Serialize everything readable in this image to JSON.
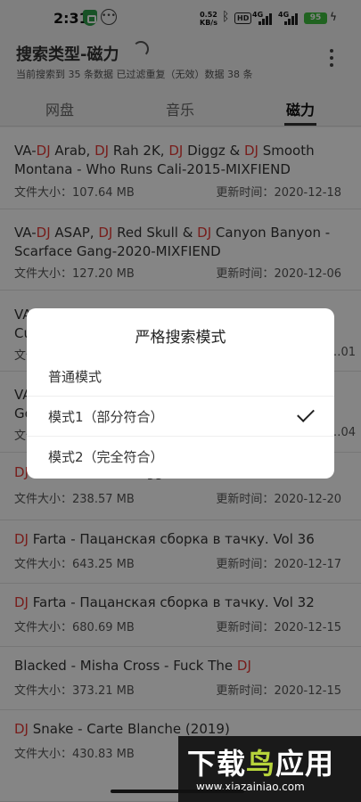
{
  "status_bar": {
    "time": "2:31",
    "speed_value": "0.52",
    "speed_unit": "KB/s",
    "hd": "HD",
    "net1": "4G",
    "net2": "4G",
    "battery": "95"
  },
  "header": {
    "title": "搜索类型-磁力",
    "subtitle": "当前搜索到 35 条数据 已过滤重复（无效）数据 38 条"
  },
  "tabs": [
    {
      "label": "网盘",
      "active": false
    },
    {
      "label": "音乐",
      "active": false
    },
    {
      "label": "磁力",
      "active": true
    }
  ],
  "list": {
    "size_label": "文件大小：",
    "date_label": "更新时间：",
    "keyword": "DJ",
    "items": [
      {
        "title": "VA-DJ Arab, DJ Rah 2K, DJ Diggz & DJ Smooth Montana - Who Runs Cali-2015-MIXFIEND",
        "size": "107.64 MB",
        "date": "2020-12-18"
      },
      {
        "title": "VA-DJ ASAP, DJ Red Skull & DJ Canyon Banyon - Scarface Gang-2020-MIXFIEND",
        "size": "127.20 MB",
        "date": "2020-12-06"
      },
      {
        "title": "VA",
        "title2": "Cu",
        "size": "",
        "date": "…01"
      },
      {
        "title": "VA",
        "title2": "Go",
        "size": "",
        "date": "…04"
      },
      {
        "title": "DJ Cam Quartet - Diggin' - 2009",
        "size": "238.57 MB",
        "date": "2020-12-20"
      },
      {
        "title": "DJ Farta - Пацанская сборка в тачку. Vol 36",
        "size": "643.25 MB",
        "date": "2020-12-17"
      },
      {
        "title": "DJ Farta - Пацанская сборка в тачку. Vol 32",
        "size": "680.69 MB",
        "date": "2020-12-15"
      },
      {
        "title": "Blacked - Misha Cross - Fuck The DJ",
        "size": "373.21 MB",
        "date": "2020-12-15"
      },
      {
        "title": "DJ Snake - Carte Blanche (2019)",
        "size": "430.83 MB",
        "date": ""
      }
    ]
  },
  "dialog": {
    "title": "严格搜索模式",
    "options": [
      {
        "label": "普通模式",
        "checked": false
      },
      {
        "label": "模式1（部分符合）",
        "checked": true
      },
      {
        "label": "模式2（完全符合）",
        "checked": false
      }
    ]
  },
  "watermark": {
    "main_a": "下载",
    "main_b": "鸟",
    "main_c": "应用",
    "url": "www.xiazainiao.com"
  },
  "colors": {
    "keyword": "#e53935",
    "battery": "#3fbf3f",
    "watermark_accent": "#b6d33b"
  }
}
